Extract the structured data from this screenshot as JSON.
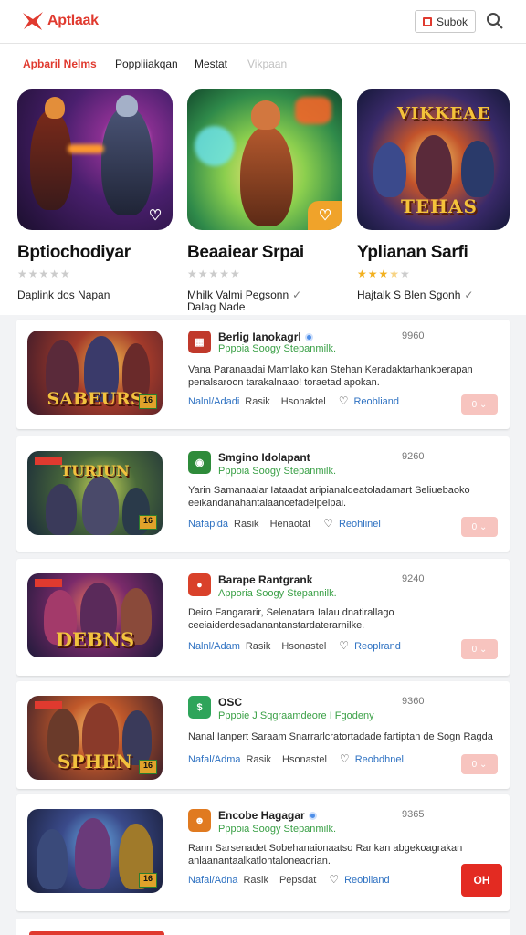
{
  "header": {
    "app_name": "Aptlaak",
    "subscribe_label": "Subok",
    "icons": [
      "logo-mark",
      "bookmark-icon",
      "search-icon"
    ],
    "accent_color": "#e03a2f"
  },
  "tabs": [
    {
      "label": "Apbaril Nelms",
      "state": "active"
    },
    {
      "label": "Poppliiakqan",
      "state": "normal"
    },
    {
      "label": "Mestat",
      "state": "normal"
    },
    {
      "label": "Vikpaan",
      "state": "faded"
    }
  ],
  "featured": [
    {
      "title": "Bptiochodiyar",
      "rating": 0,
      "subtitle": "Daplink dos Napan",
      "subtitle2": "",
      "checked": false,
      "badge_icon": "heart-icon",
      "badge_color": "#e0392b",
      "art_text": ""
    },
    {
      "title": "Beaaiear Srpai",
      "rating": 0,
      "subtitle": "Mhilk Valmi Pegsonn",
      "subtitle2": "Dalag Nade",
      "checked": true,
      "badge_icon": "heart-icon",
      "badge_color": "#f0a32a",
      "art_text": ""
    },
    {
      "title": "Yplianan Sarfi",
      "rating": 3.5,
      "subtitle": "Hajtalk S Blen Sgonh",
      "subtitle2": "",
      "checked": true,
      "badge_icon": "",
      "badge_color": "",
      "art_text_top": "VIKKEAE",
      "art_text_bottom": "TEHAS"
    }
  ],
  "apps": [
    {
      "name": "Berlig Ianokagrl",
      "verified": true,
      "category": "Pppoia Soogy Stepanmilk.",
      "size": "9960",
      "description": "Vana Paranaadai Mamlako kan Stehan Keradaktarhankberapan penalsaroon tarakalnaao! toraetad apokan.",
      "meta_a": "Nalnl/Adadi",
      "meta_b": "Rasik",
      "meta_c": "Hsonaktel",
      "meta_d": "Reobliand",
      "button": "0",
      "button_style": "pale",
      "art_text": "SABEURS",
      "icon_color": "#c0392b"
    },
    {
      "name": "Smgino Idolapant",
      "verified": false,
      "category": "Pppoia Soogy Stepanmilk.",
      "size": "9260",
      "description": "Yarin Samanaalar Iataadat aripianaldeatoladamart Seliuebaoko eeikandanahantalaancefadelpelpai.",
      "meta_a": "Nafaplda",
      "meta_b": "Rasik",
      "meta_c": "Henaotat",
      "meta_d": "Reohlinel",
      "button": "0",
      "button_style": "pale",
      "art_text": "TURIUN",
      "icon_color": "#2e8b3a"
    },
    {
      "name": "Barape Rantgrank",
      "verified": false,
      "category": "Apporia Soogy Stepannilk.",
      "size": "9240",
      "description": "Deiro Fangararir, Selenatara Ialau dnatirallago ceeiaiderdesadanantanstardaterarnilke.",
      "meta_a": "Nalnl/Adam",
      "meta_b": "Rasik",
      "meta_c": "Hsonastel",
      "meta_d": "Reoplrand",
      "button": "0",
      "button_style": "pale",
      "art_text": "DEBNS",
      "icon_color": "#d9412a"
    },
    {
      "name": "OSC",
      "verified": false,
      "category": "Pppoie J Sqgraamdeore I Fgodeny",
      "size": "9360",
      "description": "Nanal Ianpert Saraam Snarrarlcratortadade fartiptan de Sogn Ragda",
      "meta_a": "Nafal/Adma",
      "meta_b": "Rasik",
      "meta_c": "Hsonastel",
      "meta_d": "Reobdhnel",
      "button": "0",
      "button_style": "pale",
      "art_text": "SPHEN",
      "icon_color": "#2ea45a"
    },
    {
      "name": "Encobe Hagagar",
      "verified": true,
      "category": "Pppoia Soogy Stepanmilk.",
      "size": "9365",
      "description": "Rann Sarsenadet Sobehanaionaatso Rarikan abgekoagrakan anlaanantaalkatlontaloneaorian.",
      "meta_a": "Nafal/Adna",
      "meta_b": "Rasik",
      "meta_c": "Pepsdat",
      "meta_d": "Reobliand",
      "button": "OH",
      "button_style": "solid",
      "art_text": "",
      "icon_color": "#e07a20"
    }
  ]
}
